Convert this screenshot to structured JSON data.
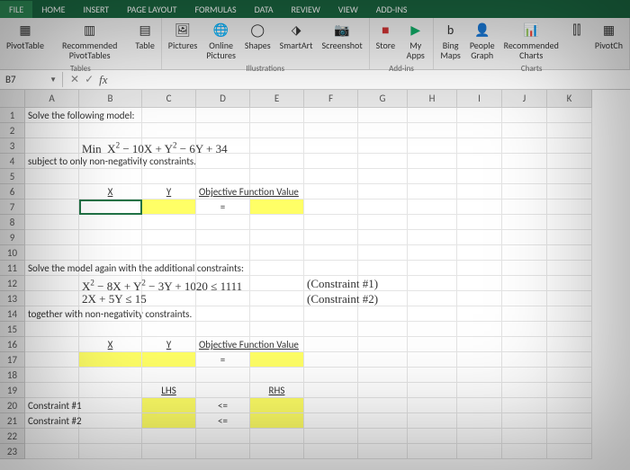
{
  "tabs": {
    "file": "FILE",
    "home": "HOME",
    "insert": "INSERT",
    "pagelayout": "PAGE LAYOUT",
    "formulas": "FORMULAS",
    "data": "DATA",
    "review": "REVIEW",
    "view": "VIEW",
    "addins": "ADD-INS"
  },
  "ribbon": {
    "tables": {
      "pivottable": "PivotTable",
      "recommended": "Recommended PivotTables",
      "table": "Table",
      "group": "Tables"
    },
    "illus": {
      "pictures": "Pictures",
      "online": "Online Pictures",
      "shapes": "Shapes",
      "smartart": "SmartArt",
      "screenshot": "Screenshot",
      "group": "Illustrations"
    },
    "addins": {
      "store": "Store",
      "myapps": "My Apps",
      "group": "Add-ins"
    },
    "charts": {
      "bing": "Bing Maps",
      "people": "People Graph",
      "recommended": "Recommended Charts",
      "pivotch": "PivotCh",
      "group": "Charts"
    }
  },
  "namebox": "B7",
  "cells": {
    "r1": "Solve the following model:",
    "r3": "Min  X² − 10X + Y² − 6Y + 34",
    "r4": "subject to only non-negativity constraints.",
    "r6x": "X",
    "r6y": "Y",
    "r6o": "Objective Function Value",
    "r7eq": "=",
    "r11": "Solve the model again with the additional constraints:",
    "r12a": "X² − 8X + Y² − 3Y + 1020 ≤ 1111",
    "r12b": "(Constraint #1)",
    "r13a": "2X + 5Y ≤ 15",
    "r13b": "(Constraint #2)",
    "r14": "together with non-negativity constraints.",
    "r16x": "X",
    "r16y": "Y",
    "r16o": "Objective Function Value",
    "r17eq": "=",
    "r19l": "LHS",
    "r19r": "RHS",
    "r20": "Constraint #1",
    "r20op": "<=",
    "r21": "Constraint #2",
    "r21op": "<="
  }
}
